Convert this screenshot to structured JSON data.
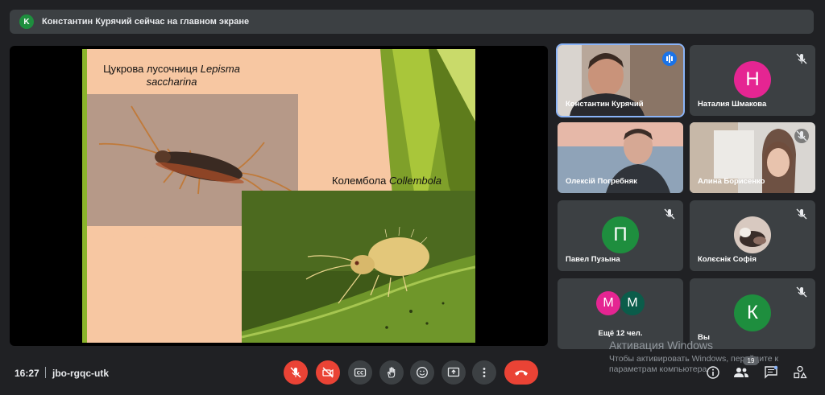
{
  "banner": {
    "avatar_letter": "K",
    "text": "Константин Курячий сейчас на главном экране"
  },
  "slide": {
    "caption1_plain": "Цукрова лусочниця ",
    "caption1_italic": "Lepisma saccharina",
    "caption2_plain": "Колембола ",
    "caption2_italic": "Collembola"
  },
  "participants": [
    {
      "name": "Константин Курячий",
      "speaking": true
    },
    {
      "name": "Наталия Шмакова",
      "letter": "Н",
      "color": "#e52592",
      "muted": true
    },
    {
      "name": "Олексій Погребняк"
    },
    {
      "name": "Алина Борисенко",
      "muted": true
    },
    {
      "name": "Павел Пузына",
      "letter": "П",
      "color": "#1e8e3e",
      "muted": true
    },
    {
      "name": "Колєснік Софія",
      "muted": true
    },
    {
      "name": "Ещё 12 чел.",
      "letters": [
        "М",
        "М"
      ],
      "colors": [
        "#e52592",
        "#0b5c4a"
      ],
      "muted": true
    },
    {
      "name": "Вы",
      "letter": "К",
      "color": "#1e8e3e",
      "muted": true
    }
  ],
  "bottom": {
    "time": "16:27",
    "meeting_code": "jbo-rgqc-utk",
    "participants_count": "19"
  },
  "watermark": {
    "title": "Активация Windows",
    "text": "Чтобы активировать Windows, перейдите к параметрам компьютера."
  },
  "colors": {
    "accent": "#8ab4f8",
    "danger": "#ea4335",
    "tile_bg": "#3c4043",
    "page_bg": "#202124"
  }
}
